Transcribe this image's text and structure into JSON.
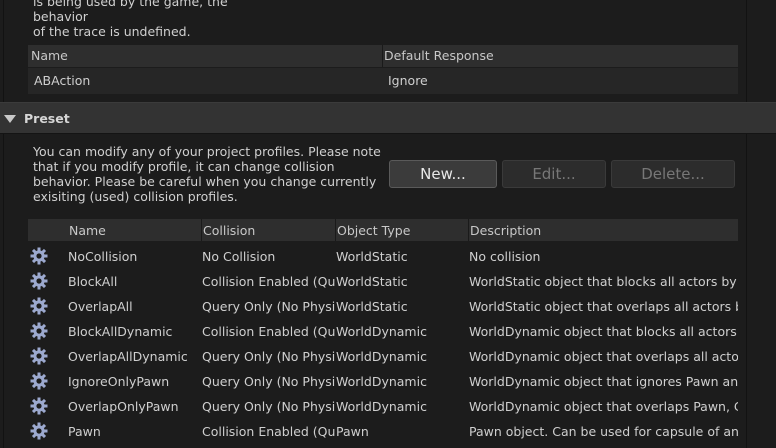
{
  "top_text": "is being used by the game, the behavior\nof the trace is undefined.",
  "channel_table": {
    "headers": {
      "name": "Name",
      "default_response": "Default Response"
    },
    "rows": [
      {
        "name": "ABAction",
        "response": "Ignore"
      }
    ]
  },
  "preset_section": {
    "label": "Preset",
    "description": "You can modify any of your project profiles. Please note that if you modify profile, it can change collision behavior. Please be careful when you change currently exisiting (used) collision profiles.",
    "buttons": {
      "new": "New...",
      "edit": "Edit...",
      "delete": "Delete..."
    }
  },
  "profiles_table": {
    "headers": {
      "name": "Name",
      "collision": "Collision",
      "object_type": "Object Type",
      "description": "Description"
    },
    "rows": [
      {
        "icon": "profile-gear-icon",
        "name": "NoCollision",
        "collision": "No Collision",
        "object_type": "WorldStatic",
        "description": "No collision"
      },
      {
        "icon": "profile-gear-icon",
        "name": "BlockAll",
        "collision": "Collision Enabled (Query",
        "object_type": "WorldStatic",
        "description": "WorldStatic object that blocks all actors by defa"
      },
      {
        "icon": "profile-gear-icon",
        "name": "OverlapAll",
        "collision": "Query Only (No Physics",
        "object_type": "WorldStatic",
        "description": "WorldStatic object that overlaps all actors by de"
      },
      {
        "icon": "profile-gear-icon",
        "name": "BlockAllDynamic",
        "collision": "Collision Enabled (Query",
        "object_type": "WorldDynamic",
        "description": "WorldDynamic object that blocks all actors by d"
      },
      {
        "icon": "profile-gear-icon",
        "name": "OverlapAllDynamic",
        "collision": "Query Only (No Physics",
        "object_type": "WorldDynamic",
        "description": "WorldDynamic object that overlaps all actors by"
      },
      {
        "icon": "profile-gear-icon",
        "name": "IgnoreOnlyPawn",
        "collision": "Query Only (No Physics",
        "object_type": "WorldDynamic",
        "description": "WorldDynamic object that ignores Pawn and Ve"
      },
      {
        "icon": "profile-gear-icon",
        "name": "OverlapOnlyPawn",
        "collision": "Query Only (No Physics",
        "object_type": "WorldDynamic",
        "description": "WorldDynamic object that overlaps Pawn, Came"
      },
      {
        "icon": "profile-gear-icon",
        "name": "Pawn",
        "collision": "Collision Enabled (Query",
        "object_type": "Pawn",
        "description": "Pawn object. Can be used for capsule of any pla"
      }
    ]
  },
  "colors": {
    "background": "#1c1c1c",
    "header": "#2e2e2e",
    "icon": "#9ca9cf"
  }
}
